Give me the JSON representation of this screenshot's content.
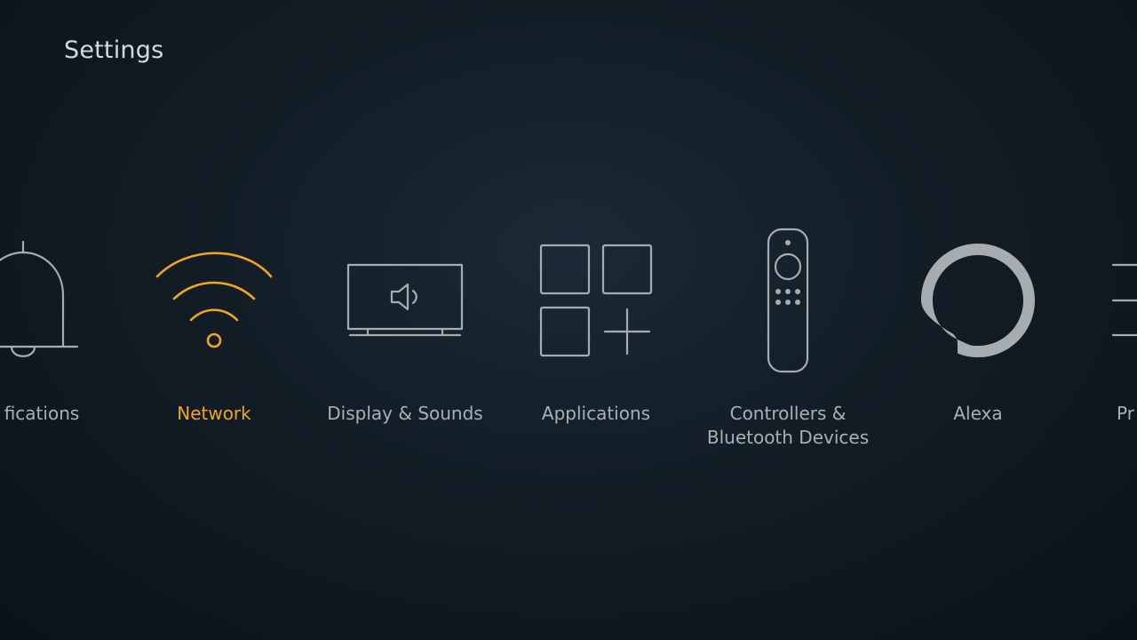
{
  "header": {
    "title": "Settings"
  },
  "colors": {
    "accent": "#f3a51f",
    "icon": "#a7acb0",
    "label": "#aab0b5",
    "title": "#d6d9dc"
  },
  "menu": {
    "selected": "network",
    "items": [
      {
        "id": "notifications",
        "label": "fications",
        "icon": "bell-icon"
      },
      {
        "id": "network",
        "label": "Network",
        "icon": "wifi-icon"
      },
      {
        "id": "display",
        "label": "Display & Sounds",
        "icon": "tv-speaker-icon"
      },
      {
        "id": "applications",
        "label": "Applications",
        "icon": "app-grid-icon"
      },
      {
        "id": "controllers",
        "label": "Controllers &\nBluetooth Devices",
        "icon": "remote-icon"
      },
      {
        "id": "alexa",
        "label": "Alexa",
        "icon": "alexa-ring-icon"
      },
      {
        "id": "preferences",
        "label": "Pr",
        "icon": "list-icon"
      }
    ]
  }
}
